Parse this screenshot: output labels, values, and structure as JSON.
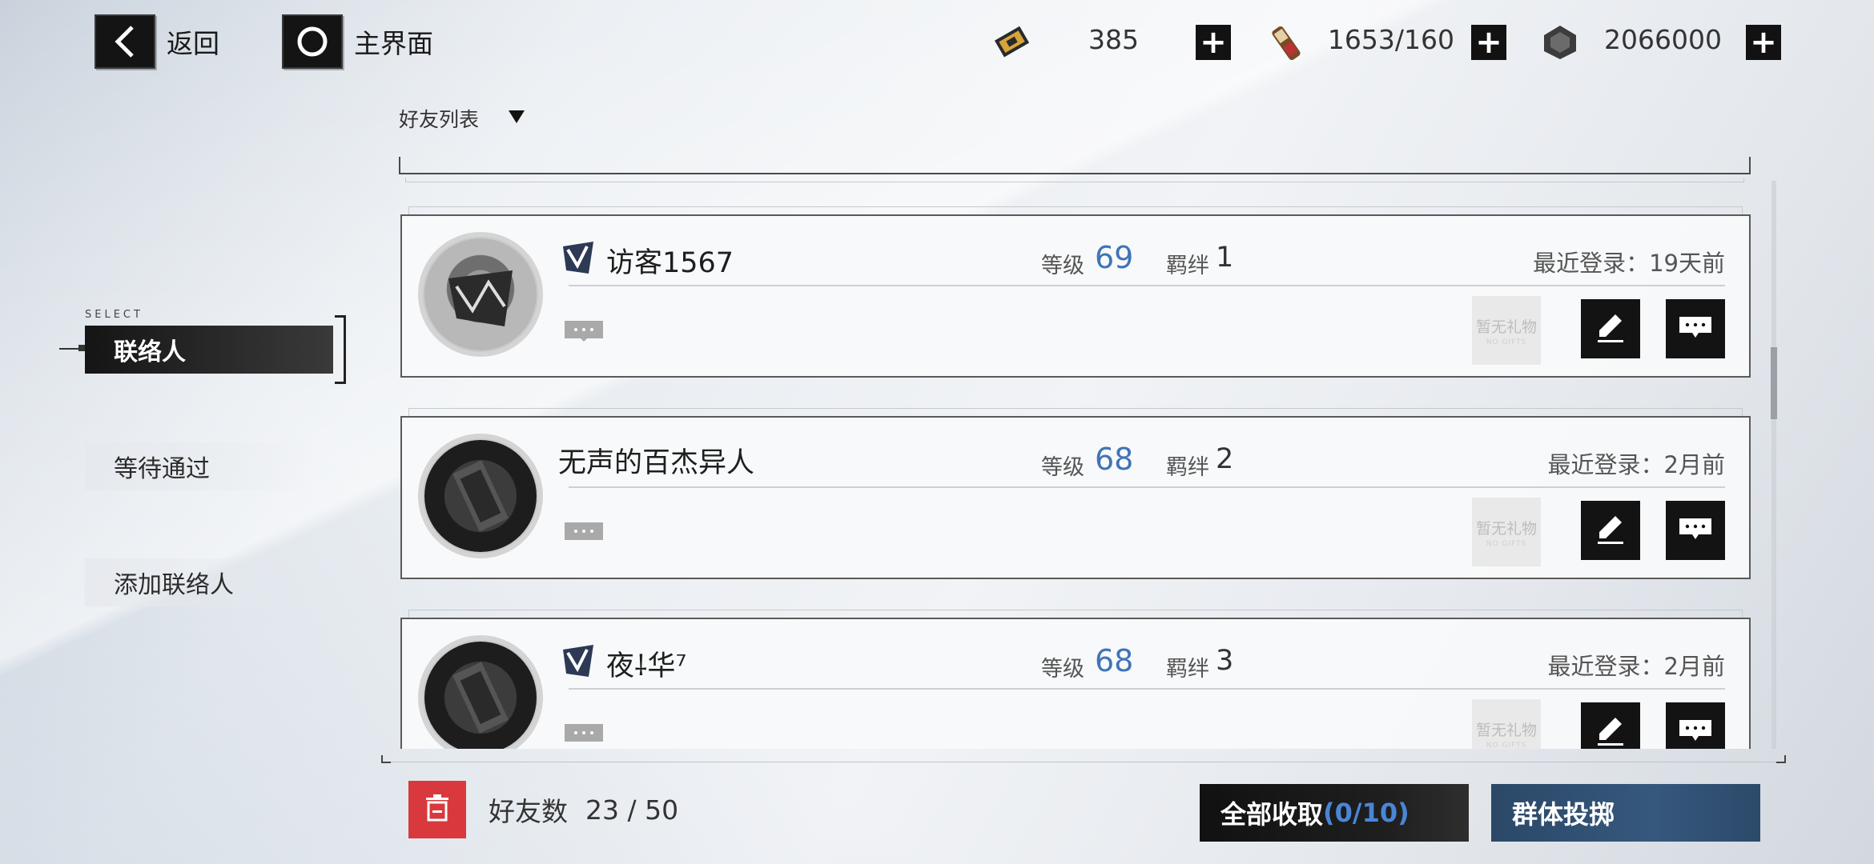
{
  "topbar": {
    "back_label": "返回",
    "home_label": "主界面",
    "resources": [
      {
        "value": "385",
        "icon": "sanity-ticket-icon"
      },
      {
        "value": "1653/160",
        "icon": "recruit-permit-icon"
      },
      {
        "value": "2066000",
        "icon": "gold-icon"
      }
    ]
  },
  "list_filter": {
    "label": "好友列表"
  },
  "sidebar": {
    "select_caption": "SELECT",
    "items": [
      {
        "label": "联络人",
        "active": true
      },
      {
        "label": "等待通过",
        "active": false
      },
      {
        "label": "添加联络人",
        "active": false
      }
    ]
  },
  "friends": [
    {
      "name": "访客1567",
      "level_label": "等级",
      "level": "69",
      "bond_label": "羁绊",
      "bond": "1",
      "last_login": "最近登录：19天前",
      "has_badge": true,
      "gift_text": "暂无礼物",
      "gift_sub": "NO GIFTS"
    },
    {
      "name": "无声的百杰异人",
      "level_label": "等级",
      "level": "68",
      "bond_label": "羁绊",
      "bond": "2",
      "last_login": "最近登录：2月前",
      "has_badge": false,
      "gift_text": "暂无礼物",
      "gift_sub": "NO GIFTS"
    },
    {
      "name": "夜⸸华⁷",
      "level_label": "等级",
      "level": "68",
      "bond_label": "羁绊",
      "bond": "3",
      "last_login": "最近登录：2月前",
      "has_badge": true,
      "gift_text": "暂无礼物",
      "gift_sub": "NO GIFTS"
    }
  ],
  "footer": {
    "friend_count_label": "好友数",
    "friend_count": "23 / 50",
    "collect_all_label": "全部收取",
    "collect_all_count": "(0/10)",
    "group_throw_label": "群体投掷"
  },
  "colors": {
    "accent_blue": "#3f74b8",
    "delete_red": "#d9393c",
    "group_btn": "#2f4e6e"
  }
}
